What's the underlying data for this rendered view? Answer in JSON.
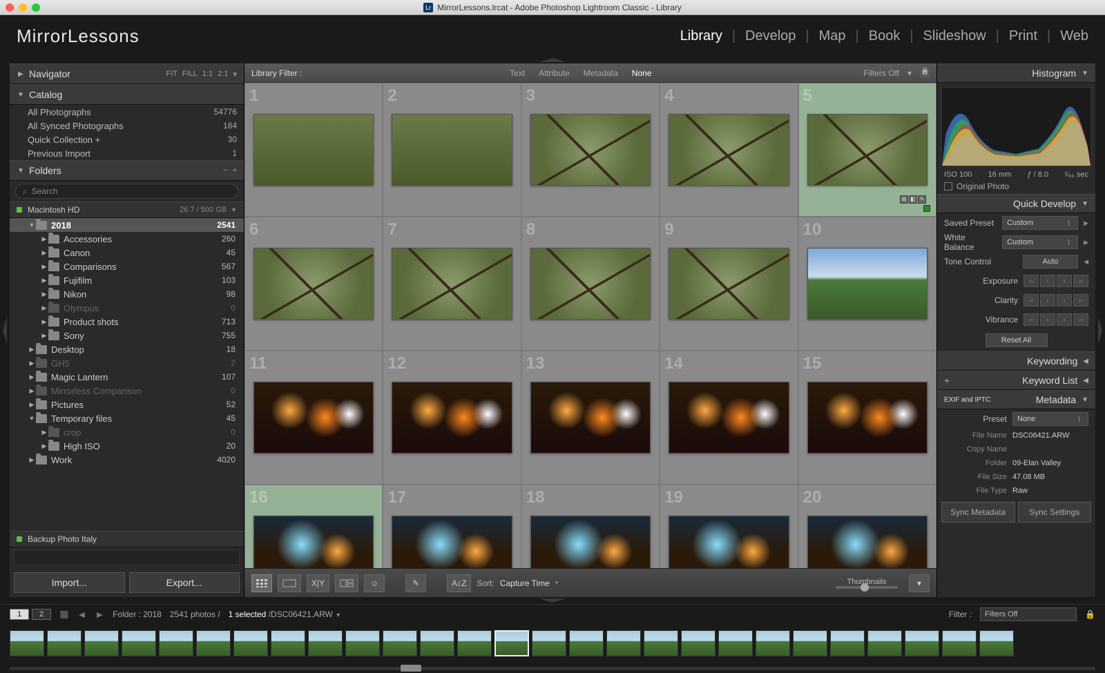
{
  "window_title": "MirrorLessons.lrcat - Adobe Photoshop Lightroom Classic - Library",
  "identity_title": "MirrorLessons",
  "modules": [
    "Library",
    "Develop",
    "Map",
    "Book",
    "Slideshow",
    "Print",
    "Web"
  ],
  "active_module": "Library",
  "navigator": {
    "label": "Navigator",
    "zoom": [
      "FIT",
      "FILL",
      "1:1",
      "2:1"
    ]
  },
  "catalog": {
    "label": "Catalog",
    "rows": [
      {
        "label": "All Photographs",
        "count": "54776"
      },
      {
        "label": "All Synced Photographs",
        "count": "184"
      },
      {
        "label": "Quick Collection  +",
        "count": "30"
      },
      {
        "label": "Previous Import",
        "count": "1"
      }
    ]
  },
  "folders": {
    "label": "Folders",
    "search_placeholder": "Search",
    "volume": {
      "name": "Macintosh HD",
      "size": "26.7 / 500 GB"
    },
    "tree": [
      {
        "d": 1,
        "open": true,
        "name": "2018",
        "count": "2541",
        "sel": true
      },
      {
        "d": 2,
        "open": false,
        "name": "Accessories",
        "count": "260"
      },
      {
        "d": 2,
        "open": false,
        "name": "Canon",
        "count": "45"
      },
      {
        "d": 2,
        "open": false,
        "name": "Comparisons",
        "count": "567"
      },
      {
        "d": 2,
        "open": false,
        "name": "Fujifilm",
        "count": "103"
      },
      {
        "d": 2,
        "open": false,
        "name": "Nikon",
        "count": "98"
      },
      {
        "d": 2,
        "open": false,
        "name": "Olympus",
        "count": "0",
        "dim": true
      },
      {
        "d": 2,
        "open": false,
        "name": "Product shots",
        "count": "713"
      },
      {
        "d": 2,
        "open": false,
        "name": "Sony",
        "count": "755"
      },
      {
        "d": 1,
        "open": false,
        "name": "Desktop",
        "count": "18"
      },
      {
        "d": 1,
        "open": false,
        "name": "GH5",
        "count": "2",
        "dim": true
      },
      {
        "d": 1,
        "open": false,
        "name": "Magic Lantern",
        "count": "107"
      },
      {
        "d": 1,
        "open": false,
        "name": "Mirrorless Comparison",
        "count": "0",
        "dim": true
      },
      {
        "d": 1,
        "open": false,
        "name": "Pictures",
        "count": "52"
      },
      {
        "d": 1,
        "open": true,
        "name": "Temporary files",
        "count": "45"
      },
      {
        "d": 2,
        "open": false,
        "name": "crop",
        "count": "0",
        "dim": true
      },
      {
        "d": 2,
        "open": false,
        "name": "High ISO",
        "count": "20"
      },
      {
        "d": 1,
        "open": false,
        "name": "Work",
        "count": "4020"
      }
    ],
    "backup_volume": "Backup Photo Italy"
  },
  "left_buttons": {
    "import": "Import...",
    "export": "Export..."
  },
  "filterbar": {
    "label": "Library Filter :",
    "options": [
      "Text",
      "Attribute",
      "Metadata",
      "None"
    ],
    "active": "None",
    "filters_off": "Filters Off"
  },
  "grid": [
    {
      "i": 1,
      "art": "art-field"
    },
    {
      "i": 2,
      "art": "art-field"
    },
    {
      "i": 3,
      "art": "art-bird"
    },
    {
      "i": 4,
      "art": "art-bird"
    },
    {
      "i": 5,
      "art": "art-bird",
      "sel": true,
      "flag": true,
      "badges": true
    },
    {
      "i": 6,
      "art": "art-bird"
    },
    {
      "i": 7,
      "art": "art-bird"
    },
    {
      "i": 8,
      "art": "art-bird"
    },
    {
      "i": 9,
      "art": "art-bird"
    },
    {
      "i": 10,
      "art": "art-sky"
    },
    {
      "i": 11,
      "art": "art-night"
    },
    {
      "i": 12,
      "art": "art-night"
    },
    {
      "i": 13,
      "art": "art-night"
    },
    {
      "i": 14,
      "art": "art-night"
    },
    {
      "i": 15,
      "art": "art-night"
    },
    {
      "i": 16,
      "art": "art-street",
      "sel": true,
      "badges": true
    },
    {
      "i": 17,
      "art": "art-street"
    },
    {
      "i": 18,
      "art": "art-street"
    },
    {
      "i": 19,
      "art": "art-street"
    },
    {
      "i": 20,
      "art": "art-street"
    }
  ],
  "toolbar": {
    "sort_label": "Sort:",
    "sort_value": "Capture Time",
    "thumb_label": "Thumbnails"
  },
  "histogram": {
    "label": "Histogram",
    "iso": "ISO 100",
    "focal": "16 mm",
    "aperture": "ƒ / 8.0",
    "shutter": "¹⁄₆₀ sec",
    "original": "Original Photo"
  },
  "quick_develop": {
    "label": "Quick Develop",
    "preset_lbl": "Saved Preset",
    "preset_val": "Custom",
    "wb_lbl": "White Balance",
    "wb_val": "Custom",
    "tone_lbl": "Tone Control",
    "tone_btn": "Auto",
    "exposure": "Exposure",
    "clarity": "Clarity",
    "vibrance": "Vibrance",
    "reset": "Reset All"
  },
  "keywording": {
    "label": "Keywording"
  },
  "keyword_list": {
    "label": "Keyword List"
  },
  "metadata": {
    "label": "Metadata",
    "mode": "EXIF and IPTC",
    "preset_lbl": "Preset",
    "preset_val": "None",
    "rows": [
      {
        "k": "File Name",
        "v": "DSC06421.ARW"
      },
      {
        "k": "Copy Name",
        "v": ""
      },
      {
        "k": "Folder",
        "v": "09-Elan Valley"
      },
      {
        "k": "File Size",
        "v": "47.08 MB"
      },
      {
        "k": "File Type",
        "v": "Raw"
      }
    ]
  },
  "sync": {
    "meta": "Sync Metadata",
    "settings": "Sync Settings"
  },
  "infobar": {
    "folder": "Folder : 2018",
    "count": "2541 photos /",
    "selected": "1 selected",
    "filename": "/DSC06421.ARW",
    "filter_lbl": "Filter :",
    "filter_val": "Filters Off"
  },
  "filmstrip_count": 27,
  "filmstrip_selected": 13
}
